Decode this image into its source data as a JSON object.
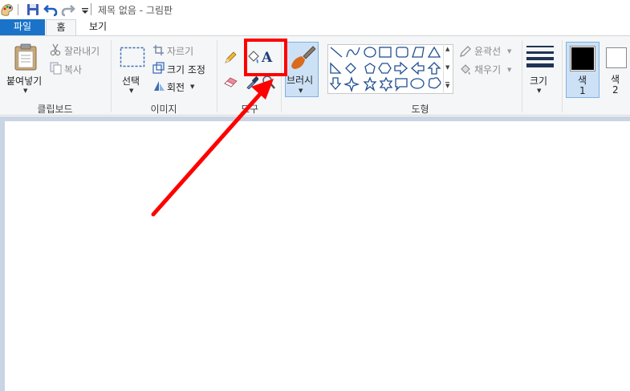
{
  "title_bar": {
    "title": "제목 없음 - 그림판",
    "icons": [
      "paint-app-icon",
      "save-icon",
      "undo-icon",
      "redo-icon",
      "customize-quick-access-icon"
    ]
  },
  "tabs": [
    {
      "label": "파일",
      "active": false
    },
    {
      "label": "홈",
      "active": true
    },
    {
      "label": "보기",
      "active": false
    }
  ],
  "ribbon": {
    "clipboard": {
      "group_label": "클립보드",
      "paste_label": "붙여넣기",
      "cut_label": "잘라내기",
      "copy_label": "복사"
    },
    "image": {
      "group_label": "이미지",
      "select_label": "선택",
      "crop_label": "자르기",
      "resize_label": "크기 조정",
      "rotate_label": "회전"
    },
    "tools": {
      "group_label": "도구",
      "text_tool_glyph": "A",
      "items": [
        "pencil-icon",
        "fill-bucket-icon",
        "text-tool-icon",
        "eraser-icon",
        "color-picker-icon",
        "magnifier-icon"
      ]
    },
    "brushes": {
      "label": "브러시"
    },
    "shapes": {
      "group_label": "도형",
      "outline_label": "윤곽선",
      "fill_label": "채우기"
    },
    "size": {
      "label": "크기"
    },
    "colors": {
      "color1_label": "색\n1",
      "color1_line1": "색",
      "color1_line2": "1",
      "color2_line1": "색",
      "color2_line2": "2",
      "color1_value": "#000000",
      "color2_value": "#ffffff"
    }
  },
  "annotation": {
    "highlight_color": "#ff0000",
    "target": "text-tool-icon"
  }
}
